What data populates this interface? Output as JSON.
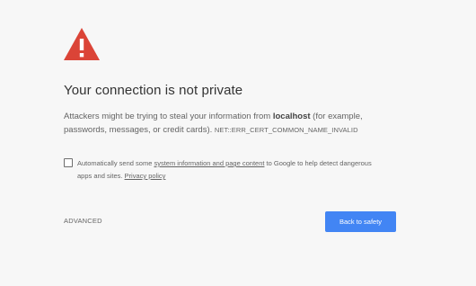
{
  "icon": {
    "name": "warning-triangle-icon",
    "color": "#db4437"
  },
  "title": "Your connection is not private",
  "explanation": {
    "prefix": "Attackers might be trying to steal your information from ",
    "host": "localhost",
    "suffix": " (for example, passwords, messages, or credit cards).",
    "error_code": "NET::ERR_CERT_COMMON_NAME_INVALID"
  },
  "optin": {
    "checked": false,
    "text_before": "Automatically send some ",
    "link_label": "system information and page content",
    "text_middle": " to Google to help detect dangerous apps and sites. ",
    "privacy_link_label": "Privacy policy"
  },
  "advanced_label": "ADVANCED",
  "back_to_safety_label": "Back to safety",
  "colors": {
    "background": "#f7f7f7",
    "primary_button": "#4285f4",
    "title_text": "#333333",
    "body_text": "#646464"
  }
}
